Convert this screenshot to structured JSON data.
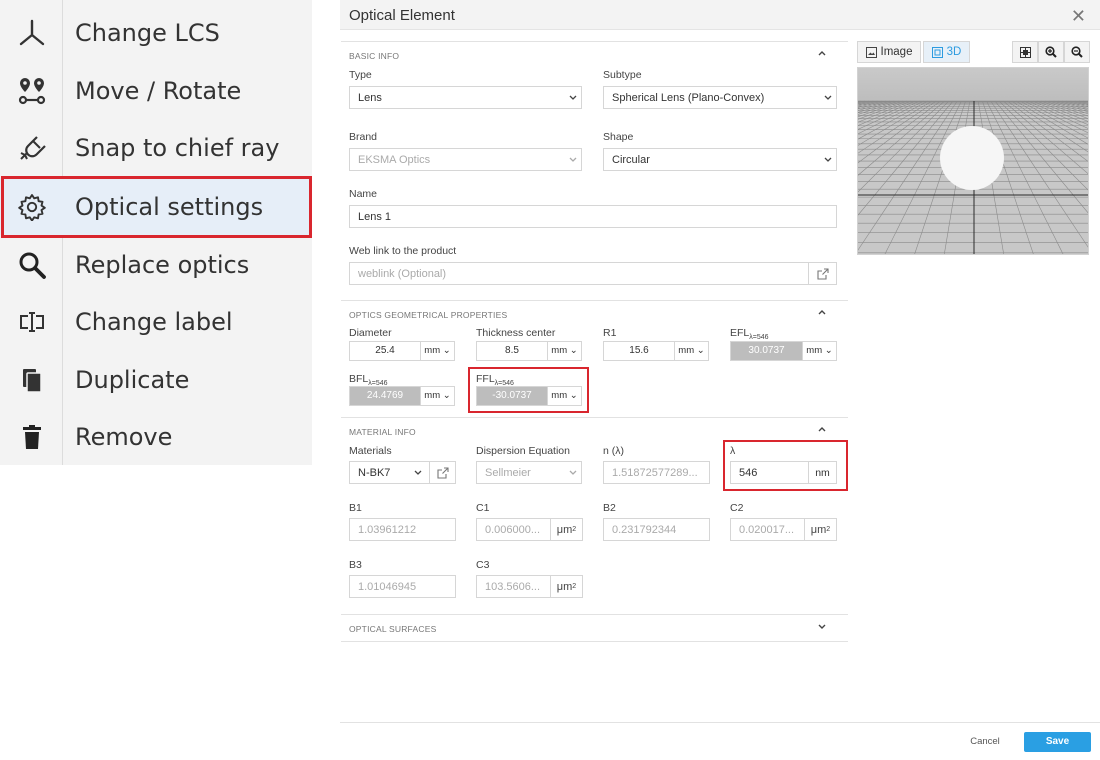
{
  "context_menu": {
    "items": [
      {
        "label": "Change LCS",
        "icon": "axes-icon"
      },
      {
        "label": "Move / Rotate",
        "icon": "move-rotate-icon"
      },
      {
        "label": "Snap to chief ray",
        "icon": "magnet-icon"
      },
      {
        "label": "Optical settings",
        "icon": "gear-icon"
      },
      {
        "label": "Replace optics",
        "icon": "search-icon"
      },
      {
        "label": "Change label",
        "icon": "label-icon"
      },
      {
        "label": "Duplicate",
        "icon": "copy-icon"
      },
      {
        "label": "Remove",
        "icon": "trash-icon"
      }
    ],
    "highlight_color": "#d9262e"
  },
  "dialog": {
    "title": "Optical Element",
    "close_glyph": "✕",
    "basic_info": {
      "heading": "BASIC INFO",
      "type_label": "Type",
      "type_value": "Lens",
      "subtype_label": "Subtype",
      "subtype_value": "Spherical Lens (Plano-Convex)",
      "brand_label": "Brand",
      "brand_value": "EKSMA Optics",
      "shape_label": "Shape",
      "shape_value": "Circular",
      "name_label": "Name",
      "name_value": "Lens 1",
      "weblink_label": "Web link to the product",
      "weblink_placeholder": "weblink (Optional)"
    },
    "geometry": {
      "heading": "OPTICS GEOMETRICAL PROPERTIES",
      "diameter_label": "Diameter",
      "diameter_value": "25.4",
      "thickness_label": "Thickness center",
      "thickness_value": "8.5",
      "r1_label": "R1",
      "r1_value": "15.6",
      "efl_label": "EFL",
      "efl_sub": "λ=546",
      "efl_value": "30.0737",
      "bfl_label": "BFL",
      "bfl_sub": "λ=546",
      "bfl_value": "24.4769",
      "ffl_label": "FFL",
      "ffl_sub": "λ=546",
      "ffl_value": "-30.0737",
      "unit": "mm"
    },
    "material": {
      "heading": "MATERIAL INFO",
      "materials_label": "Materials",
      "materials_value": "N-BK7",
      "dispersion_label": "Dispersion Equation",
      "dispersion_value": "Sellmeier",
      "n_label": "n (λ)",
      "n_value": "1.51872577289...",
      "lambda_label": "λ",
      "lambda_value": "546",
      "lambda_unit": "nm",
      "b1_label": "B1",
      "b1_value": "1.03961212",
      "c1_label": "C1",
      "c1_value": "0.006000...",
      "b2_label": "B2",
      "b2_value": "0.231792344",
      "c2_label": "C2",
      "c2_value": "0.020017...",
      "b3_label": "B3",
      "b3_value": "1.01046945",
      "c3_label": "C3",
      "c3_value": "103.5606...",
      "um_unit": "μm",
      "um_exp": "2"
    },
    "surfaces": {
      "heading": "OPTICAL SURFACES"
    },
    "viewer": {
      "image_label": "Image",
      "view3d_label": "3D",
      "active_tab": "3D"
    },
    "footer": {
      "cancel_label": "Cancel",
      "save_label": "Save"
    }
  },
  "colors": {
    "accent": "#2a9fe3",
    "highlight": "#d9262e",
    "active_bg": "#e6eef8"
  }
}
